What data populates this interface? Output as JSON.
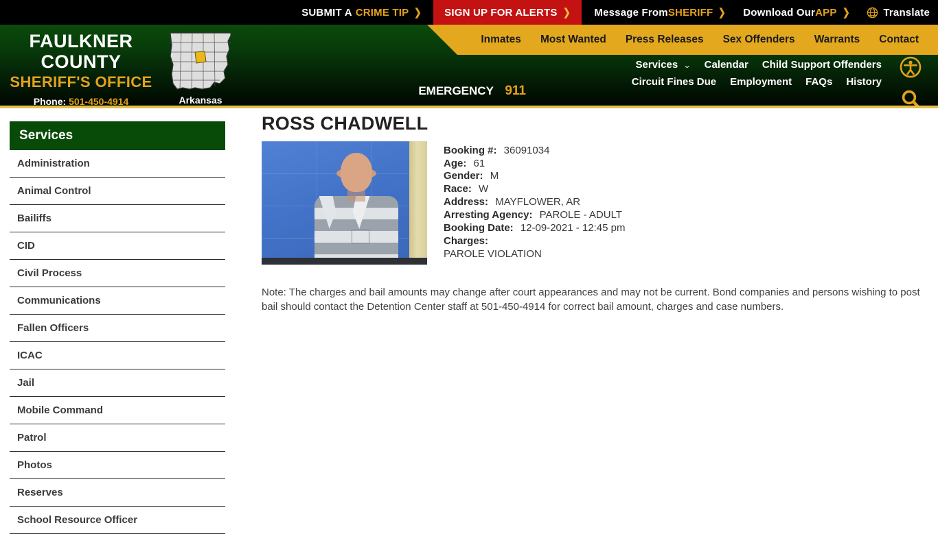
{
  "topbar": {
    "items": [
      {
        "name": "submit-crime-tip",
        "text": "SUBMIT A ",
        "accent": "CRIME TIP",
        "chevron": "❯"
      },
      {
        "name": "sign-up-alerts",
        "text": "SIGN UP FOR ALERTS",
        "accent": "",
        "chevron": "❯"
      },
      {
        "name": "message-from-sheriff",
        "text": "Message From ",
        "accent": "SHERIFF",
        "chevron": "❯"
      },
      {
        "name": "download-app",
        "text": "Download Our ",
        "accent": "APP",
        "chevron": "❯"
      }
    ],
    "translate_label": "Translate",
    "translate_icon": "globe-icon",
    "alert_bg": "#c41111",
    "accent_color": "#e3a21a"
  },
  "brand": {
    "line1": "FAULKNER COUNTY",
    "line2": "SHERIFF'S OFFICE",
    "phone_label": "Phone:",
    "phone": "501-450-4914",
    "map_label": "Arkansas",
    "map_icon": "arkansas-county-map-icon"
  },
  "mainnav": {
    "items": [
      "Inmates",
      "Most Wanted",
      "Press Releases",
      "Sex Offenders",
      "Warrants",
      "Contact"
    ],
    "bg": "#e3a81d"
  },
  "subnav": {
    "row1": [
      {
        "label": "Services",
        "has_chevron": true,
        "chevron": "⌄"
      },
      {
        "label": "Calendar",
        "has_chevron": false,
        "chevron": ""
      },
      {
        "label": "Child Support Offenders",
        "has_chevron": false,
        "chevron": ""
      }
    ],
    "row2": [
      {
        "label": "Circuit Fines Due",
        "has_chevron": false,
        "chevron": ""
      },
      {
        "label": "Employment",
        "has_chevron": false,
        "chevron": ""
      },
      {
        "label": "FAQs",
        "has_chevron": false,
        "chevron": ""
      },
      {
        "label": "History",
        "has_chevron": false,
        "chevron": ""
      }
    ],
    "emergency_label": "EMERGENCY",
    "emergency_number": "911",
    "accessibility_icon": "accessibility-icon",
    "search_icon": "search-icon"
  },
  "sidebar": {
    "heading": "Services",
    "items": [
      "Administration",
      "Animal Control",
      "Bailiffs",
      "CID",
      "Civil Process",
      "Communications",
      "Fallen Officers",
      "ICAC",
      "Jail",
      "Mobile Command",
      "Patrol",
      "Photos",
      "Reserves",
      "School Resource Officer"
    ]
  },
  "inmate": {
    "name": "ROSS CHADWELL",
    "mugshot_alt": "inmate-mugshot",
    "fields": [
      {
        "label": "Booking #:",
        "value": "36091034"
      },
      {
        "label": "Age:",
        "value": "61"
      },
      {
        "label": "Gender:",
        "value": "M"
      },
      {
        "label": "Race:",
        "value": "W"
      },
      {
        "label": "Address:",
        "value": "MAYFLOWER, AR"
      },
      {
        "label": "Arresting Agency:",
        "value": "PAROLE - ADULT"
      },
      {
        "label": "Booking Date:",
        "value": "12-09-2021 - 12:45 pm"
      }
    ],
    "charges_label": "Charges:",
    "charges": "PAROLE VIOLATION"
  },
  "note": "Note: The charges and bail amounts may change after court appearances and may not be current. Bond companies and persons wishing to post bail should contact the Detention Center staff at 501-450-4914 for correct bail amount, charges and case numbers."
}
